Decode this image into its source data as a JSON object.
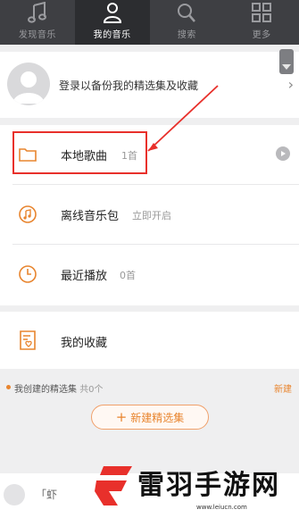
{
  "nav": {
    "tabs": [
      {
        "label": "发现音乐",
        "icon": "music-note-icon"
      },
      {
        "label": "我的音乐",
        "icon": "user-icon"
      },
      {
        "label": "搜索",
        "icon": "search-icon"
      },
      {
        "label": "更多",
        "icon": "grid-icon"
      }
    ],
    "active_index": 1
  },
  "login": {
    "text": "登录以备份我的精选集及收藏"
  },
  "list": {
    "local": {
      "label": "本地歌曲",
      "count": "1首"
    },
    "offline": {
      "label": "离线音乐包",
      "sub": "立即开启"
    },
    "recent": {
      "label": "最近播放",
      "count": "0首"
    }
  },
  "favorites": {
    "label": "我的收藏"
  },
  "section": {
    "title": "我创建的精选集",
    "count": "共0个",
    "new_label": "新建"
  },
  "new_button": {
    "label": "新建精选集",
    "plus": "+"
  },
  "bottom": {
    "text": "「虾"
  },
  "watermark": {
    "title": "雷羽手游网",
    "url": "www.leiucn.com"
  },
  "colors": {
    "accent": "#e8852f",
    "highlight": "#e8302b",
    "nav_bg": "#3e3f43"
  }
}
